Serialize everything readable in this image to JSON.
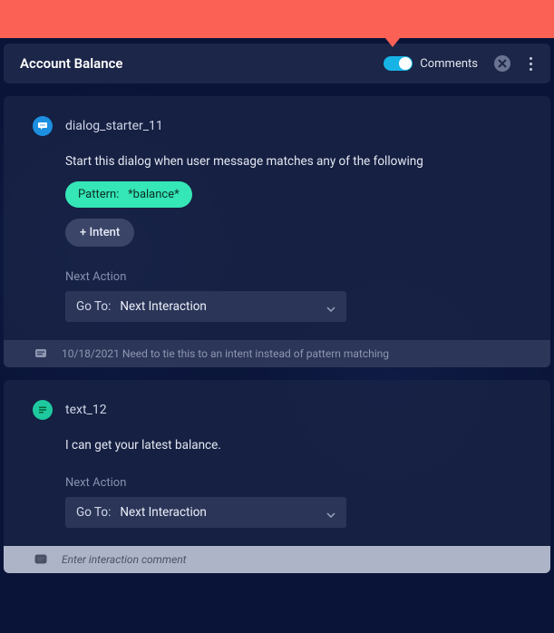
{
  "header": {
    "title": "Account Balance",
    "comments_label": "Comments",
    "comments_on": true
  },
  "cards": [
    {
      "id": "dialog_starter_11",
      "icon_type": "dialog",
      "description": "Start this dialog when user message matches any of the following",
      "pattern_chip_prefix": "Pattern:",
      "pattern_chip_value": "*balance*",
      "add_intent_label": "+ Intent",
      "next_action_label": "Next Action",
      "goto_prefix": "Go To:",
      "goto_value": "Next Interaction",
      "comment_date": "10/18/2021",
      "comment_text": "Need to tie this to an intent instead of pattern matching"
    },
    {
      "id": "text_12",
      "icon_type": "text",
      "message": "I can get your latest balance.",
      "next_action_label": "Next Action",
      "goto_prefix": "Go To:",
      "goto_value": "Next Interaction",
      "comment_placeholder": "Enter interaction comment"
    }
  ]
}
